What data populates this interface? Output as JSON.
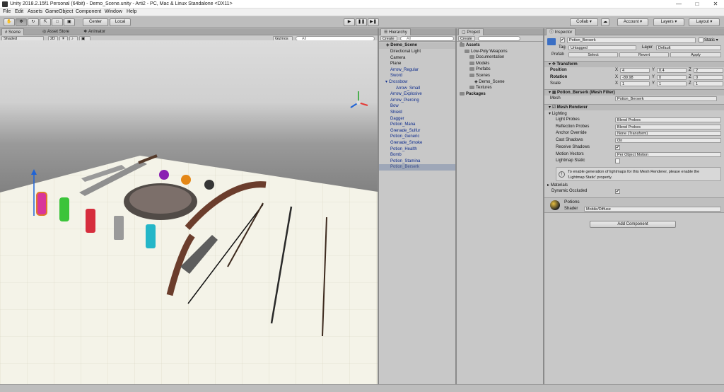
{
  "window": {
    "title": "Unity 2018.2.15f1 Personal (64bit) - Demo_Scene.unity - Arti2 - PC, Mac & Linux Standalone <DX11>",
    "controls": [
      "—",
      "□",
      "✕"
    ]
  },
  "menu": [
    "File",
    "Edit",
    "Assets",
    "GameObject",
    "Component",
    "Window",
    "Help"
  ],
  "toolbar": {
    "pivot": "Center",
    "space": "Local",
    "collab": "Collab ▾",
    "account": "Account ▾",
    "layers": "Layers ▾",
    "layout": "Layout ▾"
  },
  "scene_panel": {
    "tabs": [
      "Scene",
      "Asset Store",
      "Animator"
    ],
    "shading": "Shaded",
    "mode_2d": "2D",
    "gizmos": "Gizmos ▾",
    "search_placeholder": "All"
  },
  "hierarchy": {
    "tab": "Hierarchy",
    "create": "Create ▾",
    "search_placeholder": "All",
    "scene": "Demo_Scene",
    "items": [
      {
        "label": "Directional Light",
        "depth": 1,
        "color": "black"
      },
      {
        "label": "Camera",
        "depth": 1,
        "color": "black"
      },
      {
        "label": "Plane",
        "depth": 1,
        "color": "black"
      },
      {
        "label": "Arrow_Regular",
        "depth": 1,
        "color": "blue"
      },
      {
        "label": "Sword",
        "depth": 1,
        "color": "blue"
      },
      {
        "label": "Crossbow",
        "depth": 1,
        "color": "blue",
        "expander": true
      },
      {
        "label": "Arrow_Small",
        "depth": 2,
        "color": "blue"
      },
      {
        "label": "Arrow_Explosive",
        "depth": 1,
        "color": "blue"
      },
      {
        "label": "Arrow_Piercing",
        "depth": 1,
        "color": "blue"
      },
      {
        "label": "Bow",
        "depth": 1,
        "color": "blue"
      },
      {
        "label": "Shield",
        "depth": 1,
        "color": "blue"
      },
      {
        "label": "Dagger",
        "depth": 1,
        "color": "blue"
      },
      {
        "label": "Potion_Mana",
        "depth": 1,
        "color": "blue"
      },
      {
        "label": "Grenade_Sulfur",
        "depth": 1,
        "color": "blue"
      },
      {
        "label": "Potion_Generic",
        "depth": 1,
        "color": "blue"
      },
      {
        "label": "Grenade_Smoke",
        "depth": 1,
        "color": "blue"
      },
      {
        "label": "Potion_Health",
        "depth": 1,
        "color": "blue"
      },
      {
        "label": "Bomb",
        "depth": 1,
        "color": "blue"
      },
      {
        "label": "Potion_Stamina",
        "depth": 1,
        "color": "blue"
      },
      {
        "label": "Potion_Berserk",
        "depth": 1,
        "color": "blue",
        "selected": true
      }
    ]
  },
  "project": {
    "tab": "Project",
    "create": "Create ▾",
    "tree": [
      {
        "label": "Assets",
        "depth": 0,
        "bold": true
      },
      {
        "label": "Low-Poly Weapons",
        "depth": 1
      },
      {
        "label": "Documentation",
        "depth": 2
      },
      {
        "label": "Models",
        "depth": 2
      },
      {
        "label": "Prefabs",
        "depth": 2
      },
      {
        "label": "Scenes",
        "depth": 2
      },
      {
        "label": "Demo_Scene",
        "depth": 3,
        "scene": true
      },
      {
        "label": "Textures",
        "depth": 2
      },
      {
        "label": "Packages",
        "depth": 0,
        "bold": true
      }
    ]
  },
  "inspector": {
    "tab": "Inspector",
    "object_name": "Potion_Berserk",
    "static_label": "Static ▾",
    "tag_label": "Tag",
    "tag_value": "Untagged",
    "layer_label": "Layer",
    "layer_value": "Default",
    "prefab_label": "Prefab",
    "prefab_select": "Select",
    "prefab_revert": "Revert",
    "prefab_apply": "Apply",
    "transform": {
      "title": "Transform",
      "rows": [
        {
          "label": "Position",
          "x": "4",
          "y": "0.4",
          "z": "2"
        },
        {
          "label": "Rotation",
          "x": "-89.98",
          "y": "0",
          "z": "0"
        },
        {
          "label": "Scale",
          "x": "1",
          "y": "1",
          "z": "1"
        }
      ]
    },
    "mesh_filter": {
      "title": "Potion_Berserk (Mesh Filter)",
      "mesh_label": "Mesh",
      "mesh_value": "Potion_Berserk"
    },
    "mesh_renderer": {
      "title": "Mesh Renderer",
      "lighting_label": "Lighting",
      "rows": [
        {
          "label": "Light Probes",
          "value": "Blend Probes",
          "kind": "dropdown"
        },
        {
          "label": "Reflection Probes",
          "value": "Blend Probes",
          "kind": "dropdown"
        },
        {
          "label": "Anchor Override",
          "value": "None (Transform)",
          "kind": "object"
        },
        {
          "label": "Cast Shadows",
          "value": "On",
          "kind": "dropdown"
        },
        {
          "label": "Receive Shadows",
          "value": "✔",
          "kind": "check"
        },
        {
          "label": "Motion Vectors",
          "value": "Per Object Motion",
          "kind": "dropdown"
        },
        {
          "label": "Lightmap Static",
          "value": "",
          "kind": "check"
        }
      ],
      "info_line1": "To enable generation of lightmaps for this Mesh Renderer, please enable the",
      "info_line2": "'Lightmap Static' property.",
      "materials_label": "Materials",
      "dynamic_occluded_label": "Dynamic Occluded",
      "dynamic_occluded_value": "✔"
    },
    "material": {
      "name": "Potions",
      "shader_label": "Shader",
      "shader_value": "Mobile/Diffuse"
    },
    "add_component": "Add Component"
  },
  "colors": {
    "selection": "#9ea7b8",
    "prefab_blue": "#0b2a8c",
    "panel_bg": "#c8c8c8",
    "toolbar_bg": "#bdbdbd"
  }
}
